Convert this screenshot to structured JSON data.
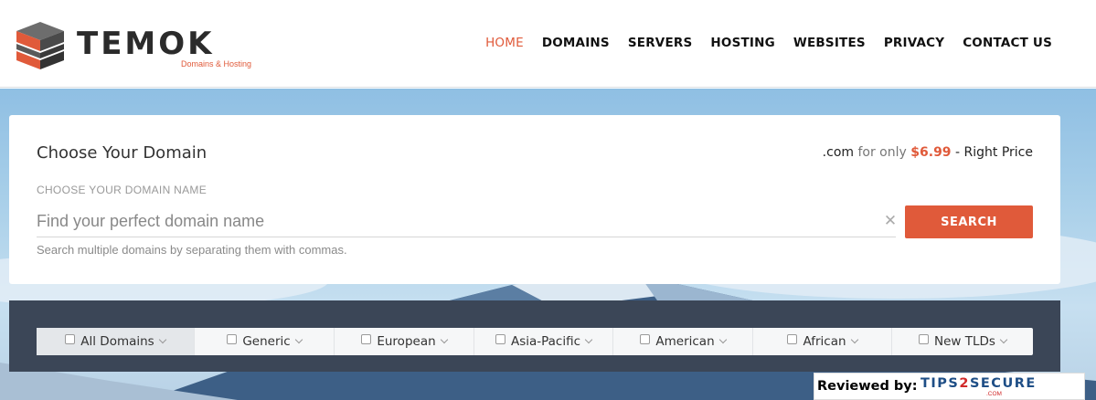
{
  "brand": {
    "name": "TEMOK",
    "tagline": "Domains & Hosting",
    "accent": "#e05a3a"
  },
  "nav": {
    "items": [
      {
        "label": "HOME",
        "active": true
      },
      {
        "label": "DOMAINS",
        "active": false
      },
      {
        "label": "SERVERS",
        "active": false
      },
      {
        "label": "HOSTING",
        "active": false
      },
      {
        "label": "WEBSITES",
        "active": false
      },
      {
        "label": "PRIVACY",
        "active": false
      },
      {
        "label": "CONTACT US",
        "active": false
      }
    ]
  },
  "domain_search": {
    "title": "Choose Your Domain",
    "price_tld": ".com",
    "price_prefix": "for only",
    "price_amount": "$6.99",
    "price_suffix": "- Right Price",
    "field_label": "CHOOSE YOUR DOMAIN NAME",
    "placeholder": "Find your perfect domain name",
    "value": "",
    "clear_icon": "close-icon",
    "button_label": "SEARCH",
    "hint": "Search multiple domains by separating them with commas."
  },
  "filters": {
    "tabs": [
      {
        "label": "All Domains",
        "checked": false,
        "selected": true
      },
      {
        "label": "Generic",
        "checked": false,
        "selected": false
      },
      {
        "label": "European",
        "checked": false,
        "selected": false
      },
      {
        "label": "Asia-Pacific",
        "checked": false,
        "selected": false
      },
      {
        "label": "American",
        "checked": false,
        "selected": false
      },
      {
        "label": "African",
        "checked": false,
        "selected": false
      },
      {
        "label": "New TLDs",
        "checked": false,
        "selected": false
      }
    ]
  },
  "reviewed_badge": {
    "label": "Reviewed by:",
    "logo_left": "TIPS",
    "logo_mid": "2",
    "logo_right": "SECURE",
    "logo_sub": ".COM"
  }
}
